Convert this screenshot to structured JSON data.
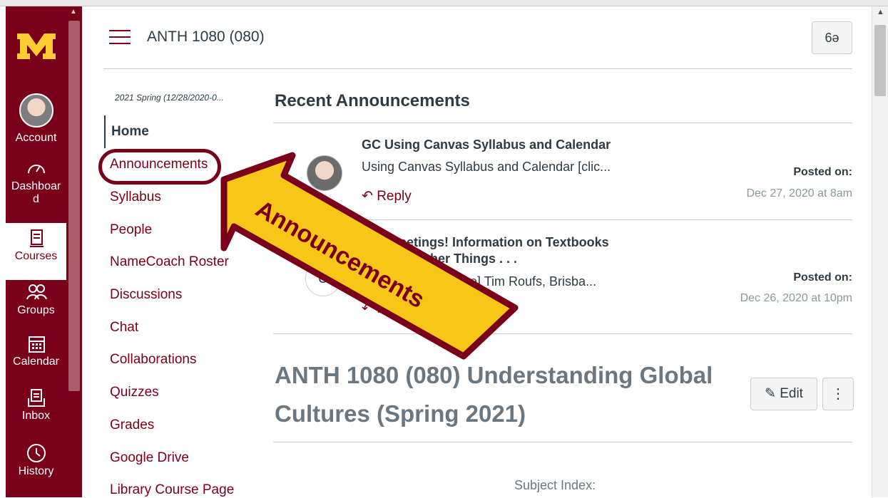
{
  "global_nav": {
    "items": [
      {
        "label": "Account"
      },
      {
        "label": "Dashboard"
      },
      {
        "label": "Courses"
      },
      {
        "label": "Groups"
      },
      {
        "label": "Calendar"
      },
      {
        "label": "Inbox"
      },
      {
        "label": "History"
      }
    ],
    "dashboard_line1": "Dashboar",
    "dashboard_line2": "d"
  },
  "header": {
    "course_title": "ANTH 1080 (080)",
    "view_toggle_icon": "glasses-icon"
  },
  "course_nav": {
    "term": "2021 Spring (12/28/2020-0...",
    "items": [
      {
        "label": "Home",
        "active": true
      },
      {
        "label": "Announcements"
      },
      {
        "label": "Syllabus"
      },
      {
        "label": "People"
      },
      {
        "label": "NameCoach Roster"
      },
      {
        "label": "Discussions"
      },
      {
        "label": "Chat"
      },
      {
        "label": "Collaborations"
      },
      {
        "label": "Quizzes"
      },
      {
        "label": "Grades"
      },
      {
        "label": "Google Drive"
      },
      {
        "label": "Library Course Page"
      }
    ]
  },
  "main": {
    "recent_title": "Recent Announcements",
    "announcements": [
      {
        "title": "GC Using Canvas Syllabus and Calendar",
        "preview": "Using Canvas Syllabus and Calendar [clic...",
        "reply": "Reply",
        "posted_label": "Posted on:",
        "posted_date": "Dec 27, 2020 at 8am"
      },
      {
        "title_line1": "Greetings! Information on Textbooks",
        "title_line2": "her Things . . .",
        "preview": "k ↑ here] Tim Roufs, Brisba...",
        "avatar_initial": "U",
        "reply": "R",
        "posted_label": "Posted on:",
        "posted_date": "Dec 26, 2020 at 10pm"
      }
    ],
    "page_title_line1": "ANTH 1080 (080) Understanding Global",
    "page_title_line2": "Cultures (Spring 2021)",
    "edit_label": "Edit",
    "kebab_icon": "more-vertical-icon",
    "subject_index": "Subject Index:"
  },
  "callout": {
    "text": "Announcements",
    "fill": "#f5c518",
    "stroke": "#7a0019"
  },
  "colors": {
    "brand_maroon": "#7a0019",
    "brand_gold": "#ffcc33"
  }
}
